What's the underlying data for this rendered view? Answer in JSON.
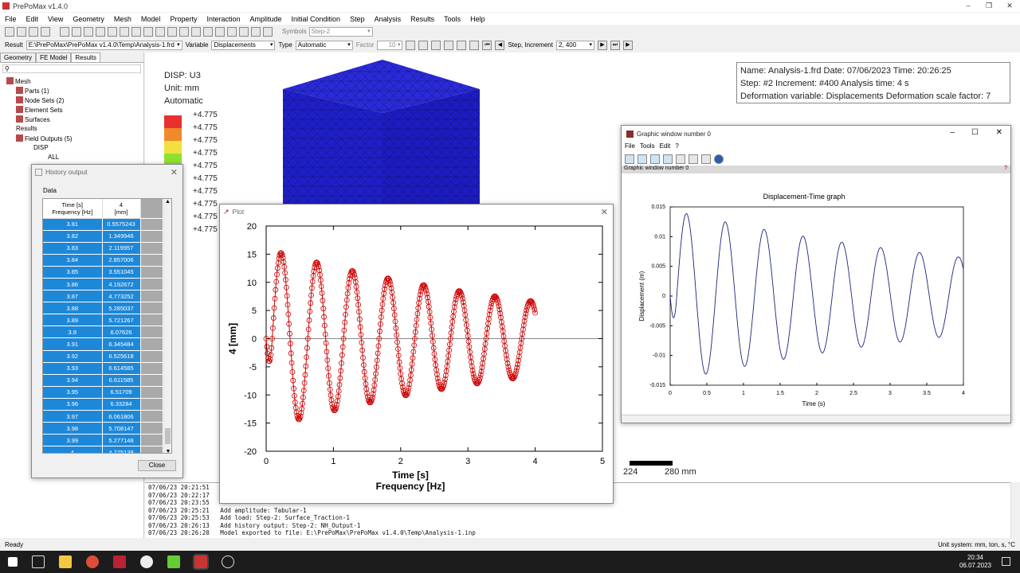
{
  "app": {
    "title": "PrePoMax v1.4.0"
  },
  "menu": [
    "File",
    "Edit",
    "View",
    "Geometry",
    "Mesh",
    "Model",
    "Property",
    "Interaction",
    "Amplitude",
    "Initial Condition",
    "Step",
    "Analysis",
    "Results",
    "Tools",
    "Help"
  ],
  "toolbar": {
    "symbols_label": "Symbols",
    "symbols_value": "Step-2",
    "result_label": "Result",
    "result_path": "E:\\PrePoMax\\PrePoMax v1.4.0\\Temp\\Analysis-1.frd",
    "variable_label": "Variable",
    "variable_value": "Displacements",
    "type_label": "Type",
    "type_value": "Automatic",
    "factor_label": "Factor",
    "factor_value": "10",
    "step_inc_label": "Step, Increment",
    "step_inc_value": "2, 400"
  },
  "tree": {
    "tabs": [
      "Geometry",
      "FE Model",
      "Results"
    ],
    "nodes": [
      "Mesh",
      "Parts (1)",
      "Node Sets (2)",
      "Element Sets",
      "Surfaces",
      "Results",
      "Field Outputs (5)",
      "DISP",
      "ALL"
    ]
  },
  "viewport": {
    "legend_title": [
      "DISP: U3",
      "Unit: mm",
      "Automatic"
    ],
    "legend_values": [
      "+4.775",
      "+4.775",
      "+4.775",
      "+4.775",
      "+4.775",
      "+4.775",
      "+4.775",
      "+4.775",
      "+4.775",
      "+4.775"
    ],
    "legend_colors": [
      "#e83030",
      "#f08a2a",
      "#f0e040",
      "#90e030",
      "#30c060",
      "#30c0c0",
      "#3080e0",
      "#2040e0",
      "#2030d0",
      "#2020c0"
    ],
    "info": [
      "Name: Analysis-1.frd   Date: 07/06/2023   Time: 20:26:25",
      "Step: #2   Increment: #400   Analysis time: 4 s",
      "Deformation variable: Displacements   Deformation scale factor: 7"
    ],
    "scale_labels": [
      "224",
      "280 mm"
    ]
  },
  "history": {
    "title": "History output",
    "group": "Data",
    "col1": [
      "Time [s]",
      "Frequency [Hz]"
    ],
    "col2": [
      "4",
      "[mm]"
    ],
    "rows": [
      [
        "3.81",
        "0.5575243"
      ],
      [
        "3.82",
        "1.349946"
      ],
      [
        "3.83",
        "2.119957"
      ],
      [
        "3.84",
        "2.857006"
      ],
      [
        "3.85",
        "3.551045"
      ],
      [
        "3.86",
        "4.192672"
      ],
      [
        "3.87",
        "4.773252"
      ],
      [
        "3.88",
        "5.285037"
      ],
      [
        "3.89",
        "5.721267"
      ],
      [
        "3.9",
        "6.07626"
      ],
      [
        "3.91",
        "6.345484"
      ],
      [
        "3.92",
        "6.525618"
      ],
      [
        "3.93",
        "6.614585"
      ],
      [
        "3.94",
        "6.611585"
      ],
      [
        "3.95",
        "6.51709"
      ],
      [
        "3.96",
        "6.33284"
      ],
      [
        "3.97",
        "6.061806"
      ],
      [
        "3.98",
        "5.708147"
      ],
      [
        "3.99",
        "5.277148"
      ],
      [
        "4",
        "4.775138"
      ]
    ],
    "close": "Close"
  },
  "plot_window": {
    "title": "Plot"
  },
  "graphic_window": {
    "title": "Graphic window number 0",
    "menu": [
      "File",
      "Tools",
      "Edit",
      "?"
    ],
    "subbar": "Graphic window number 0",
    "help": "?"
  },
  "chart_data": [
    {
      "type": "scatter",
      "title": "",
      "xlabel": "Time [s]",
      "xlabel2": "Frequency [Hz]",
      "ylabel": "4 [mm]",
      "xlim": [
        0,
        5
      ],
      "ylim": [
        -20,
        20
      ],
      "xticks": [
        "0",
        "1",
        "2",
        "3",
        "4",
        "5"
      ],
      "yticks": [
        "20",
        "15",
        "10",
        "5",
        "0",
        "-5",
        "-10",
        "-15",
        "-20"
      ],
      "series": [
        {
          "amp_start": 16,
          "amp_end": 6.6,
          "period": 0.53,
          "x_end": 4.0,
          "color": "#cc0000"
        }
      ],
      "peaks": [
        [
          0.22,
          16.0
        ],
        [
          0.48,
          -15.0
        ],
        [
          0.75,
          14.0
        ],
        [
          1.02,
          -13.0
        ],
        [
          1.28,
          12.4
        ],
        [
          1.55,
          -11.5
        ],
        [
          1.81,
          10.9
        ],
        [
          2.08,
          -10.3
        ],
        [
          2.34,
          9.7
        ],
        [
          2.6,
          -9.1
        ],
        [
          2.87,
          8.5
        ],
        [
          3.13,
          -8.0
        ],
        [
          3.39,
          7.5
        ],
        [
          3.66,
          -7.0
        ],
        [
          3.93,
          6.6
        ]
      ],
      "grid": false
    },
    {
      "type": "line",
      "title": "Displacement-Time graph",
      "xlabel": "Time (s)",
      "ylabel": "Displacement (m)",
      "xlim": [
        0,
        4
      ],
      "ylim": [
        -0.015,
        0.015
      ],
      "xticks": [
        "0",
        "0.5",
        "1",
        "1.5",
        "2",
        "2.5",
        "3",
        "3.5",
        "4"
      ],
      "yticks": [
        "0.015",
        "0.01",
        "0.005",
        "0",
        "-0.005",
        "-0.01",
        "-0.015"
      ],
      "series": [
        {
          "amp_start": 0.0145,
          "amp_end": 0.0065,
          "period": 0.53,
          "color": "#1a237e"
        }
      ],
      "grid": false
    }
  ],
  "console": [
    "07/06/23 20:21:51",
    "07/06/23 20:22:17",
    "07/06/23 20:23:55",
    "07/06/23 20:25:21   Add amplitude: Tabular-1",
    "07/06/23 20:25:53   Add load: Step-2: Surface_Traction-1",
    "07/06/23 20:26:13   Add history output: Step-2: NH_Output-1",
    "07/06/23 20:26:20   Model exported to file: E:\\PrePoMax\\PrePoMax v1.4.0\\Temp\\Analysis-1.inp"
  ],
  "status": {
    "left": "Ready",
    "right": "Unit system: mm, ton, s, °C"
  },
  "taskbar": {
    "time": "20:34",
    "date": "06.07.2023"
  }
}
